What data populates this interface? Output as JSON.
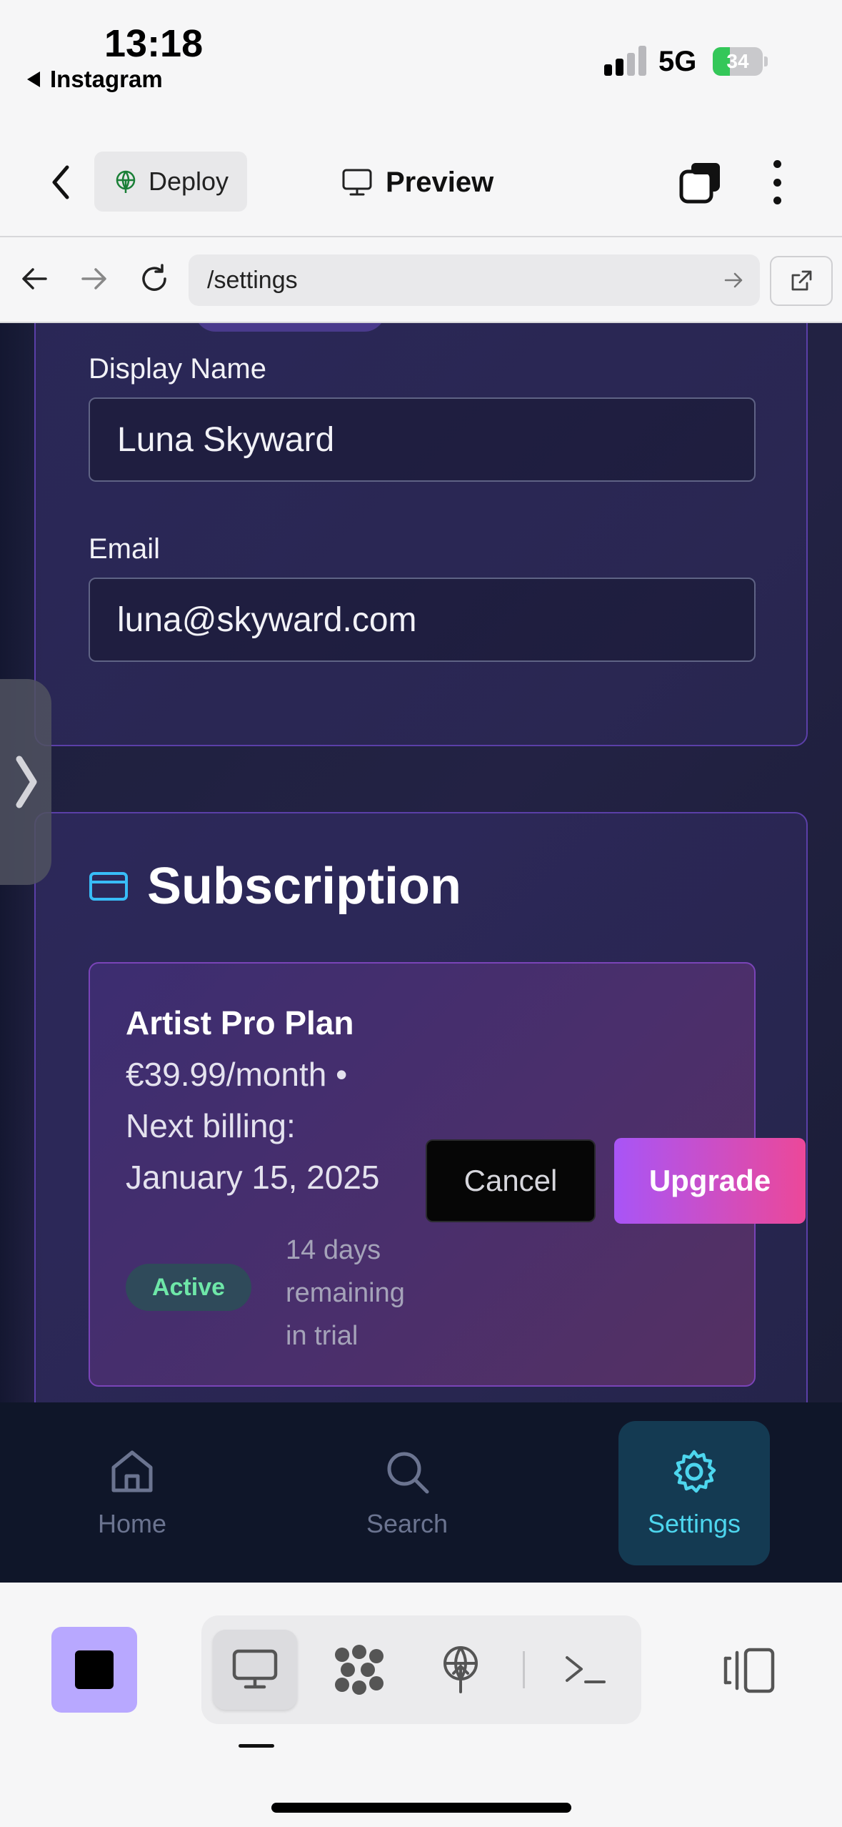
{
  "status_bar": {
    "time": "13:18",
    "back_app": "Instagram",
    "network": "5G",
    "battery": "34",
    "battery_level": 0.34
  },
  "toolbar": {
    "deploy_label": "Deploy",
    "preview_label": "Preview"
  },
  "browser": {
    "url": "/settings"
  },
  "profile": {
    "display_name_label": "Display Name",
    "display_name_value": "Luna Skyward",
    "email_label": "Email",
    "email_value": "luna@skyward.com"
  },
  "subscription": {
    "title": "Subscription",
    "plan_name": "Artist Pro Plan",
    "price_line": "€39.99/month •",
    "billing_line_1": "Next billing:",
    "billing_line_2": "January 15, 2025",
    "status_badge": "Active",
    "trial_line_1": "14 days",
    "trial_line_2": "remaining",
    "trial_line_3": "in trial",
    "cancel_label": "Cancel",
    "upgrade_label": "Upgrade"
  },
  "bottom_nav": {
    "items": [
      {
        "label": "Home",
        "icon": "home-icon",
        "active": false
      },
      {
        "label": "Search",
        "icon": "search-icon",
        "active": false
      },
      {
        "label": "Settings",
        "icon": "gear-icon",
        "active": true
      }
    ]
  },
  "colors": {
    "accent_cyan": "#4dd6ee",
    "upgrade_gradient_start": "#a855f7",
    "upgrade_gradient_end": "#ec4899",
    "active_green": "#6ee7a8",
    "card_border": "#5b3fa8"
  }
}
